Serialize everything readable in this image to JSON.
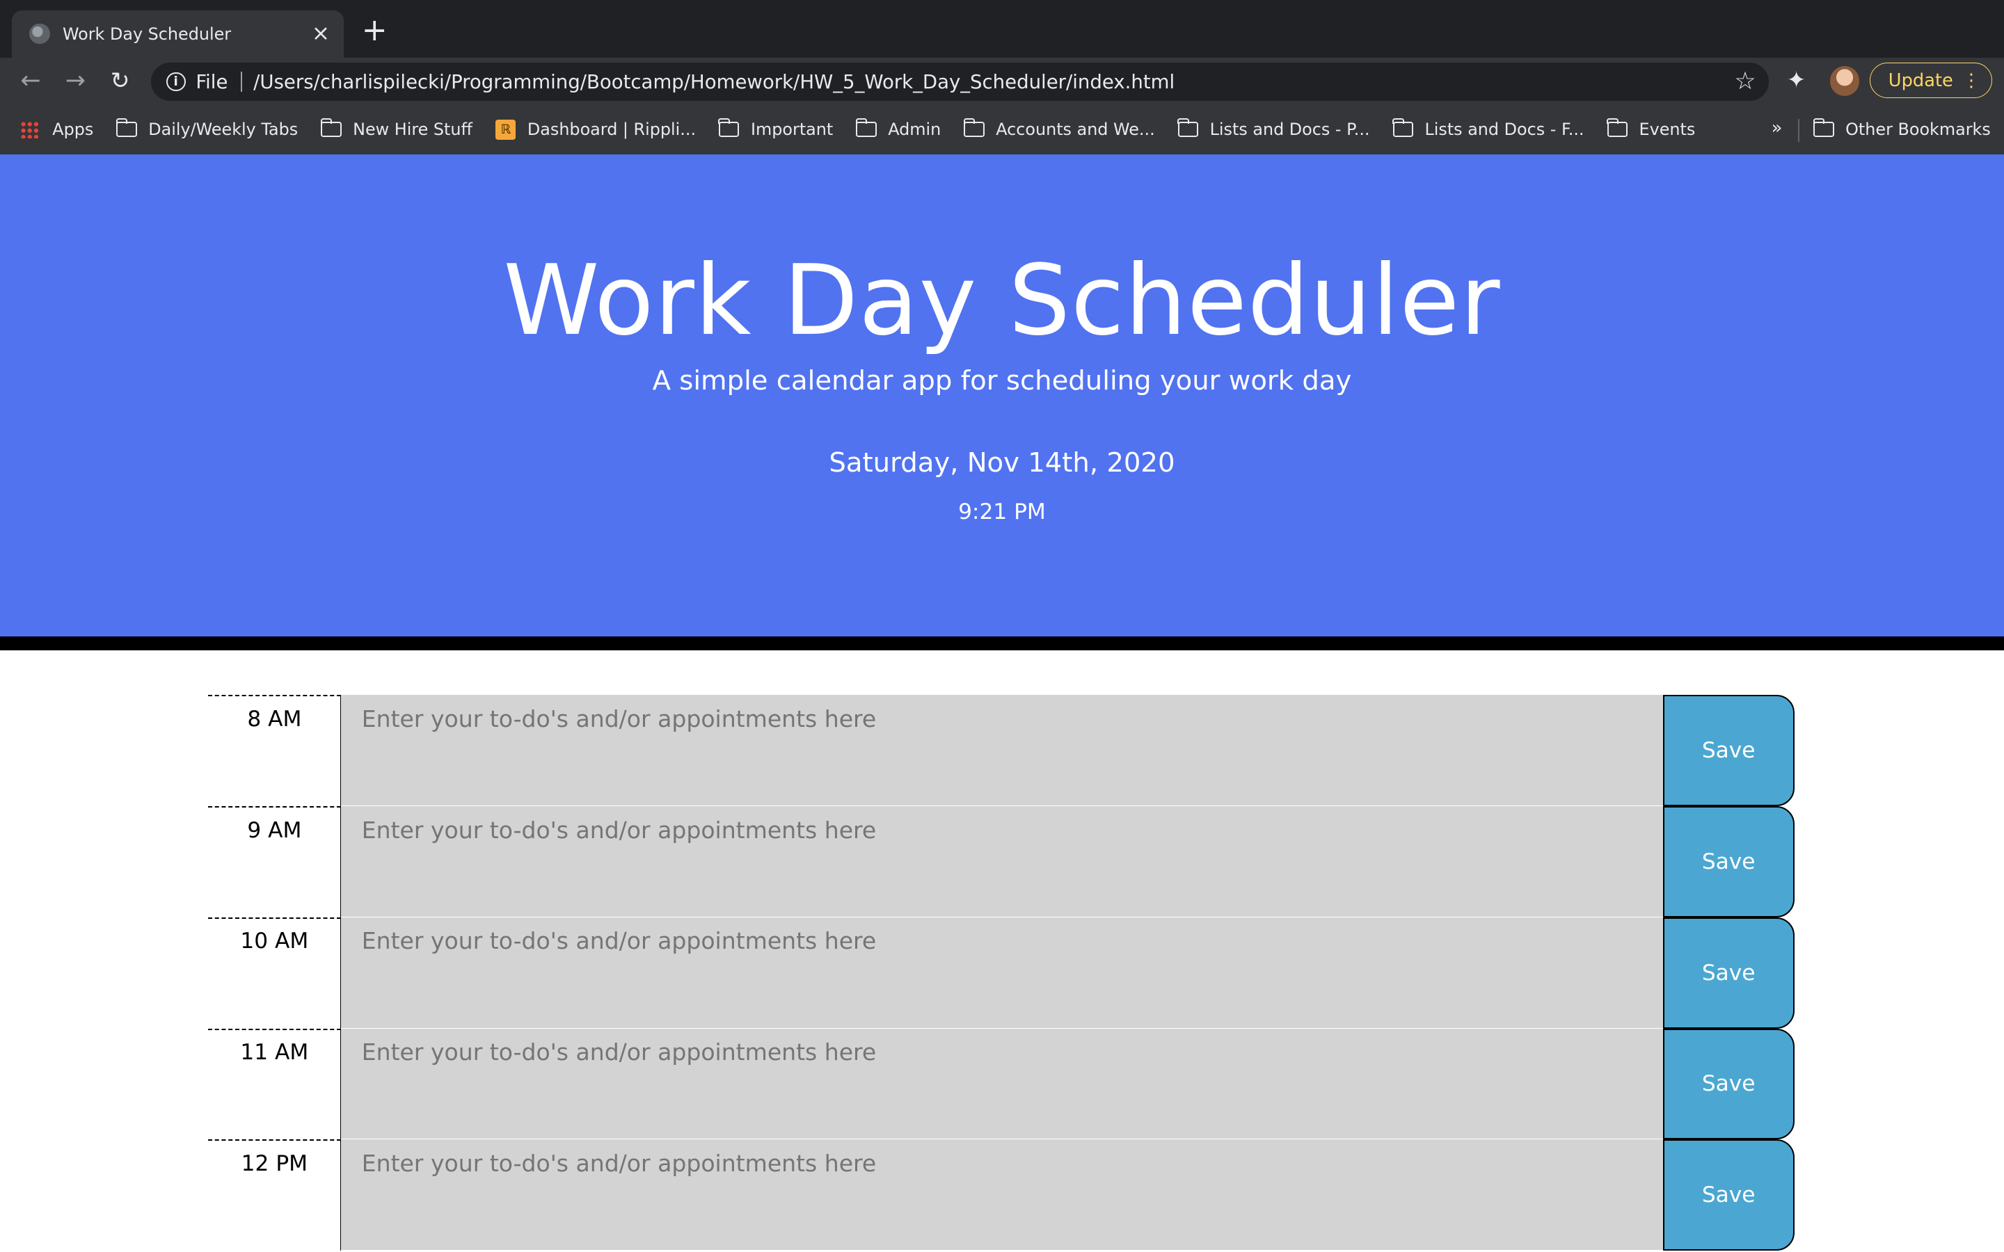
{
  "browser": {
    "tab_title": "Work Day Scheduler",
    "scheme": "File",
    "url": "/Users/charlispilecki/Programming/Bootcamp/Homework/HW_5_Work_Day_Scheduler/index.html",
    "update_label": "Update",
    "bookmarks": [
      {
        "label": "Apps",
        "icon": "apps-grid-icon"
      },
      {
        "label": "Daily/Weekly Tabs",
        "icon": "folder-icon"
      },
      {
        "label": "New Hire Stuff",
        "icon": "folder-icon"
      },
      {
        "label": "Dashboard | Rippli...",
        "icon": "rippling-icon"
      },
      {
        "label": "Important",
        "icon": "folder-icon"
      },
      {
        "label": "Admin",
        "icon": "folder-icon"
      },
      {
        "label": "Accounts and We...",
        "icon": "folder-icon"
      },
      {
        "label": "Lists and Docs - P...",
        "icon": "folder-icon"
      },
      {
        "label": "Lists and Docs - F...",
        "icon": "folder-icon"
      },
      {
        "label": "Events",
        "icon": "folder-icon"
      }
    ],
    "overflow_label": "»",
    "other_bookmarks": "Other Bookmarks"
  },
  "header": {
    "title": "Work Day Scheduler",
    "lead": "A simple calendar app for scheduling your work day",
    "date": "Saturday, Nov 14th, 2020",
    "time": "9:21 PM"
  },
  "schedule": {
    "placeholder": "Enter your to-do's and/or appointments here",
    "save_label": "Save",
    "hours": [
      "8 AM",
      "9 AM",
      "10 AM",
      "11 AM",
      "12 PM"
    ]
  },
  "colors": {
    "jumbotron": "#5173f0",
    "past_block": "#d3d3d3",
    "save_button": "#4ba7d1",
    "update_accent": "#fdd663"
  }
}
